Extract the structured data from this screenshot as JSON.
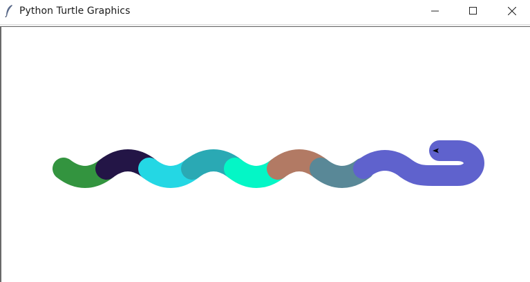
{
  "window": {
    "title": "Python Turtle Graphics",
    "app_icon": "feather-icon",
    "controls": {
      "minimize_icon": "minimize-icon",
      "maximize_icon": "maximize-icon",
      "close_icon": "close-icon"
    }
  },
  "canvas": {
    "background": "#ffffff",
    "turtle_color": "#000000",
    "snake_segments": [
      {
        "name": "segment-1",
        "color": "#33943f"
      },
      {
        "name": "segment-2",
        "color": "#231546"
      },
      {
        "name": "segment-3",
        "color": "#24d7e4"
      },
      {
        "name": "segment-4",
        "color": "#2aa9b4"
      },
      {
        "name": "segment-5",
        "color": "#04f6c6"
      },
      {
        "name": "segment-6",
        "color": "#b27a64"
      },
      {
        "name": "segment-7",
        "color": "#598897"
      },
      {
        "name": "segment-8",
        "color": "#5f62cd"
      }
    ]
  }
}
